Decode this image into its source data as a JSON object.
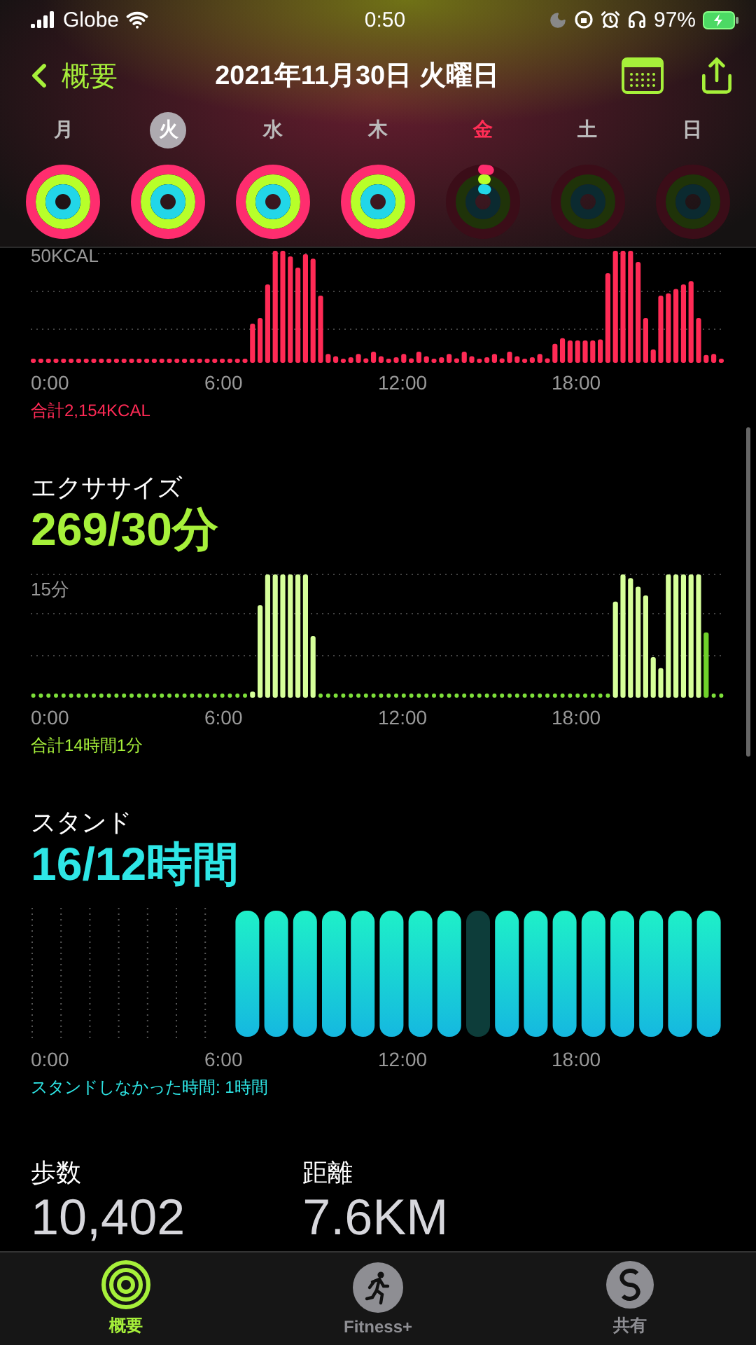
{
  "status_bar": {
    "carrier": "Globe",
    "time": "0:50",
    "battery": "97%"
  },
  "nav": {
    "back": "概要",
    "title": "2021年11月30日 火曜日"
  },
  "days": [
    {
      "label": "月",
      "selected": false,
      "today": false,
      "kind": "closed"
    },
    {
      "label": "火",
      "selected": true,
      "today": false,
      "kind": "closed"
    },
    {
      "label": "水",
      "selected": false,
      "today": false,
      "kind": "closed"
    },
    {
      "label": "木",
      "selected": false,
      "today": false,
      "kind": "closed"
    },
    {
      "label": "金",
      "selected": false,
      "today": true,
      "kind": "started"
    },
    {
      "label": "土",
      "selected": false,
      "today": false,
      "kind": "empty"
    },
    {
      "label": "日",
      "selected": false,
      "today": false,
      "kind": "empty"
    }
  ],
  "sections": [
    {
      "kind": "move",
      "scale_label": "50KCAL",
      "axis": [
        "0:00",
        "6:00",
        "12:00",
        "18:00"
      ],
      "total": "合計2,154KCAL"
    },
    {
      "kind": "exercise",
      "title": "エクササイズ",
      "value": "269/30分",
      "scale_label": "15分",
      "axis": [
        "0:00",
        "6:00",
        "12:00",
        "18:00"
      ],
      "total": "合計14時間1分"
    },
    {
      "kind": "stand",
      "title": "スタンド",
      "value": "16/12時間",
      "axis": [
        "0:00",
        "6:00",
        "12:00",
        "18:00"
      ],
      "total": "スタンドしなかった時間: 1時間"
    }
  ],
  "stats": [
    {
      "label": "歩数",
      "value": "10,402"
    },
    {
      "label": "距離",
      "value": "7.6KM"
    }
  ],
  "tab_bar": [
    {
      "label": "概要",
      "selected": true
    },
    {
      "label": "Fitness+",
      "selected": false
    },
    {
      "label": "共有",
      "selected": false
    }
  ]
}
